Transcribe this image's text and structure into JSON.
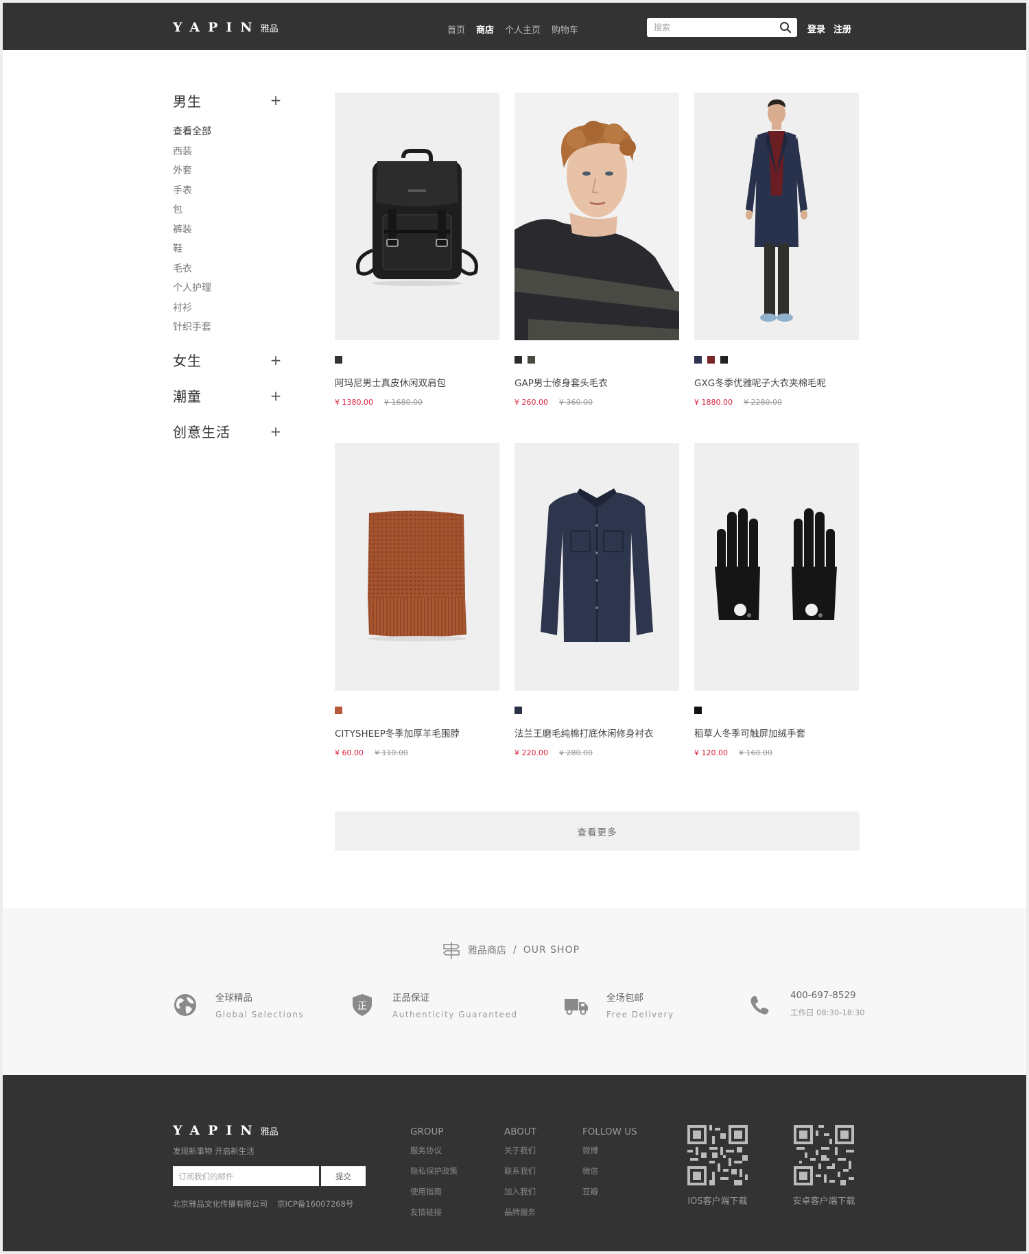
{
  "header": {
    "logo_mark": "YAPIN",
    "logo_cn": "雅品",
    "nav": [
      {
        "label": "首页"
      },
      {
        "label": "商店"
      },
      {
        "label": "个人主页"
      },
      {
        "label": "购物车"
      }
    ],
    "search_placeholder": "搜索",
    "login_label": "登录",
    "register_label": "注册"
  },
  "sidebar": {
    "groups": [
      {
        "title": "男生",
        "items": [
          "查看全部",
          "西装",
          "外套",
          "手表",
          "包",
          "裤装",
          "鞋",
          "毛衣",
          "个人护理",
          "衬衫",
          "针织手套"
        ]
      },
      {
        "title": "女生"
      },
      {
        "title": "潮童"
      },
      {
        "title": "创意生活"
      }
    ]
  },
  "products": [
    {
      "name": "阿玛尼男士真皮休闲双肩包",
      "price": "¥ 1380.00",
      "old_price": "¥ 1680.00",
      "image": "backpack",
      "swatches": [
        "#333333"
      ]
    },
    {
      "name": "GAP男士修身套头毛衣",
      "price": "¥ 260.00",
      "old_price": "¥ 360.00",
      "image": "sweater-model",
      "swatches": [
        "#2b2b2b",
        "#4a4a40"
      ]
    },
    {
      "name": "GXG冬季优雅呢子大衣夹棉毛呢",
      "price": "¥ 1880.00",
      "old_price": "¥ 2280.00",
      "image": "coat-model",
      "swatches": [
        "#2c3550",
        "#7a2424",
        "#222222"
      ]
    },
    {
      "name": "CITYSHEEP冬季加厚羊毛围脖",
      "price": "¥ 60.00",
      "old_price": "¥ 110.00",
      "image": "scarf",
      "swatches": [
        "#b55a3a"
      ]
    },
    {
      "name": "法兰王磨毛纯棉打底休闲修身衬衣",
      "price": "¥ 220.00",
      "old_price": "¥ 280.00",
      "image": "denim-shirt",
      "swatches": [
        "#2a3146"
      ]
    },
    {
      "name": "稻草人冬季可触屏加绒手套",
      "price": "¥ 120.00",
      "old_price": "¥ 160.00",
      "image": "gloves",
      "swatches": [
        "#111111"
      ]
    }
  ],
  "more_label": "查看更多",
  "services": {
    "shop_cn": "雅品商店",
    "shop_sep": "/",
    "shop_en": "OUR SHOP",
    "items": [
      {
        "icon": "globe-icon",
        "cn": "全球精品",
        "en": "Global Selections"
      },
      {
        "icon": "shield-icon",
        "cn": "正品保证",
        "en": "Authenticity Guaranteed",
        "badge": "正"
      },
      {
        "icon": "truck-icon",
        "cn": "全场包邮",
        "en": "Free Delivery"
      },
      {
        "icon": "phone-icon",
        "cn": "400-697-8529",
        "en": "工作日 08:30-18:30"
      }
    ]
  },
  "footer": {
    "logo_mark": "YAPIN",
    "logo_cn": "雅品",
    "slogan": "发现新事物  开启新生活",
    "subscribe_placeholder": "订阅我们的邮件",
    "subscribe_button": "提交",
    "company": "北京雅品文化传播有限公司",
    "icp": "京ICP备16007268号",
    "columns": [
      {
        "title": "GROUP",
        "links": [
          "服务协议",
          "隐私保护政策",
          "使用指南",
          "友情链接"
        ]
      },
      {
        "title": "ABOUT",
        "links": [
          "关于我们",
          "联系我们",
          "加入我们",
          "品牌服务"
        ]
      },
      {
        "title": "FOLLOW US",
        "links": [
          "微博",
          "微信",
          "豆瓣"
        ]
      }
    ],
    "qr": [
      {
        "label": "IOS客户端下载"
      },
      {
        "label": "安卓客户端下载"
      }
    ]
  }
}
